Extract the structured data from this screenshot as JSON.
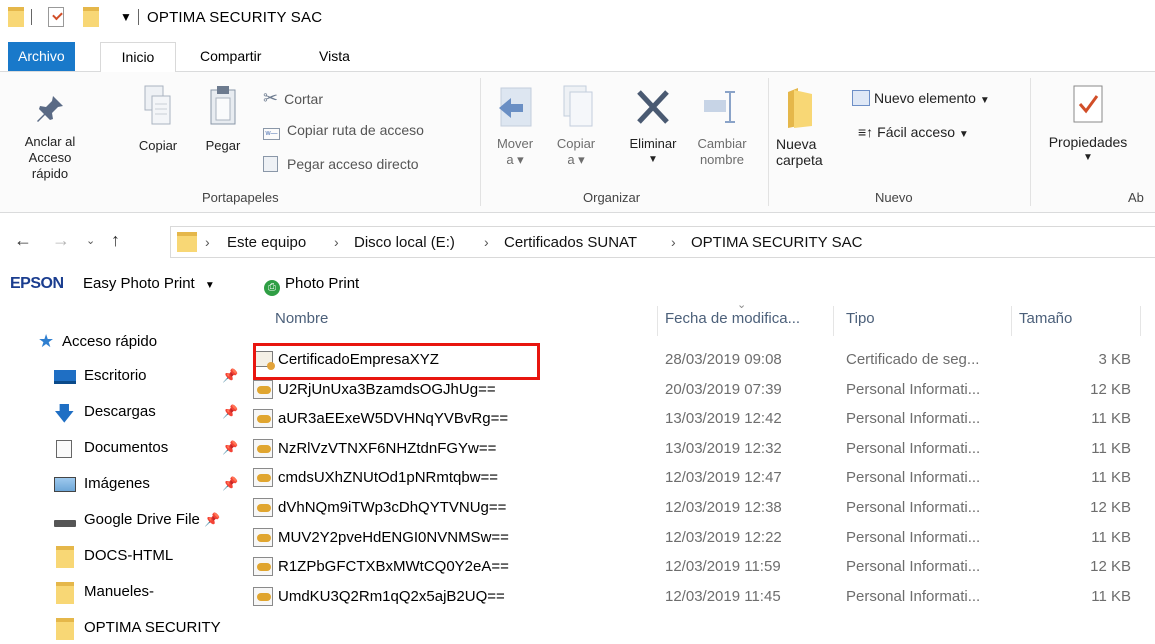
{
  "window": {
    "title": "OPTIMA SECURITY SAC"
  },
  "ribbon": {
    "tabs": [
      "Archivo",
      "Inicio",
      "Compartir",
      "Vista"
    ],
    "portapapeles": {
      "label": "Portapapeles",
      "pin_line1": "Anclar al",
      "pin_line2": "Acceso rápido",
      "copy": "Copiar",
      "paste": "Pegar",
      "cut": "Cortar",
      "copy_path": "Copiar ruta de acceso",
      "paste_shortcut": "Pegar acceso directo"
    },
    "organizar": {
      "label": "Organizar",
      "move_line1": "Mover",
      "move_line2": "a",
      "copy_line1": "Copiar",
      "copy_line2": "a",
      "delete": "Eliminar",
      "rename_line1": "Cambiar",
      "rename_line2": "nombre"
    },
    "nuevo": {
      "label": "Nuevo",
      "new_folder_line1": "Nueva",
      "new_folder_line2": "carpeta",
      "new_item": "Nuevo elemento",
      "easy_access": "Fácil acceso"
    },
    "abrir": {
      "label": "Ab",
      "properties": "Propiedades"
    }
  },
  "address": {
    "breadcrumbs": [
      "Este equipo",
      "Disco local (E:)",
      "Certificados SUNAT",
      "OPTIMA SECURITY SAC"
    ]
  },
  "epson": {
    "brand": "EPSON",
    "easy_photo": "Easy Photo Print",
    "photo_print": "Photo Print"
  },
  "nav": {
    "items": [
      {
        "label": "Acceso rápido",
        "icon": "star-icon"
      },
      {
        "label": "Escritorio",
        "icon": "desktop-icon"
      },
      {
        "label": "Descargas",
        "icon": "download-icon"
      },
      {
        "label": "Documentos",
        "icon": "document-icon"
      },
      {
        "label": "Imágenes",
        "icon": "image-icon"
      },
      {
        "label": "Google Drive File",
        "icon": "drive-icon"
      },
      {
        "label": "DOCS-HTML",
        "icon": "folder-icon"
      },
      {
        "label": "Manueles-",
        "icon": "folder-icon"
      },
      {
        "label": "OPTIMA SECURITY",
        "icon": "folder-icon"
      }
    ]
  },
  "columns": [
    "Nombre",
    "Fecha de modifica...",
    "Tipo",
    "Tamaño"
  ],
  "files": [
    {
      "name": "CertificadoEmpresaXYZ",
      "date": "28/03/2019 09:08",
      "type": "Certificado de seg...",
      "size": "3 KB"
    },
    {
      "name": "U2RjUnUxa3BzamdsOGJhUg==",
      "date": "20/03/2019 07:39",
      "type": "Personal Informati...",
      "size": "12 KB"
    },
    {
      "name": "aUR3aEExeW5DVHNqYVBvRg==",
      "date": "13/03/2019 12:42",
      "type": "Personal Informati...",
      "size": "11 KB"
    },
    {
      "name": "NzRlVzVTNXF6NHZtdnFGYw==",
      "date": "13/03/2019 12:32",
      "type": "Personal Informati...",
      "size": "11 KB"
    },
    {
      "name": "cmdsUXhZNUtOd1pNRmtqbw==",
      "date": "12/03/2019 12:47",
      "type": "Personal Informati...",
      "size": "11 KB"
    },
    {
      "name": "dVhNQm9iTWp3cDhQYTVNUg==",
      "date": "12/03/2019 12:38",
      "type": "Personal Informati...",
      "size": "12 KB"
    },
    {
      "name": "MUV2Y2pveHdENGI0NVNMSw==",
      "date": "12/03/2019 12:22",
      "type": "Personal Informati...",
      "size": "11 KB"
    },
    {
      "name": "R1ZPbGFCTXBxMWtCQ0Y2eA==",
      "date": "12/03/2019 11:59",
      "type": "Personal Informati...",
      "size": "12 KB"
    },
    {
      "name": "UmdKU3Q2Rm1qQ2x5ajB2UQ==",
      "date": "12/03/2019 11:45",
      "type": "Personal Informati...",
      "size": "11 KB"
    }
  ],
  "colors": {
    "accent": "#1979ca",
    "folder": "#f8d775",
    "highlight": "#e8150f",
    "header_text": "#4c607a"
  }
}
